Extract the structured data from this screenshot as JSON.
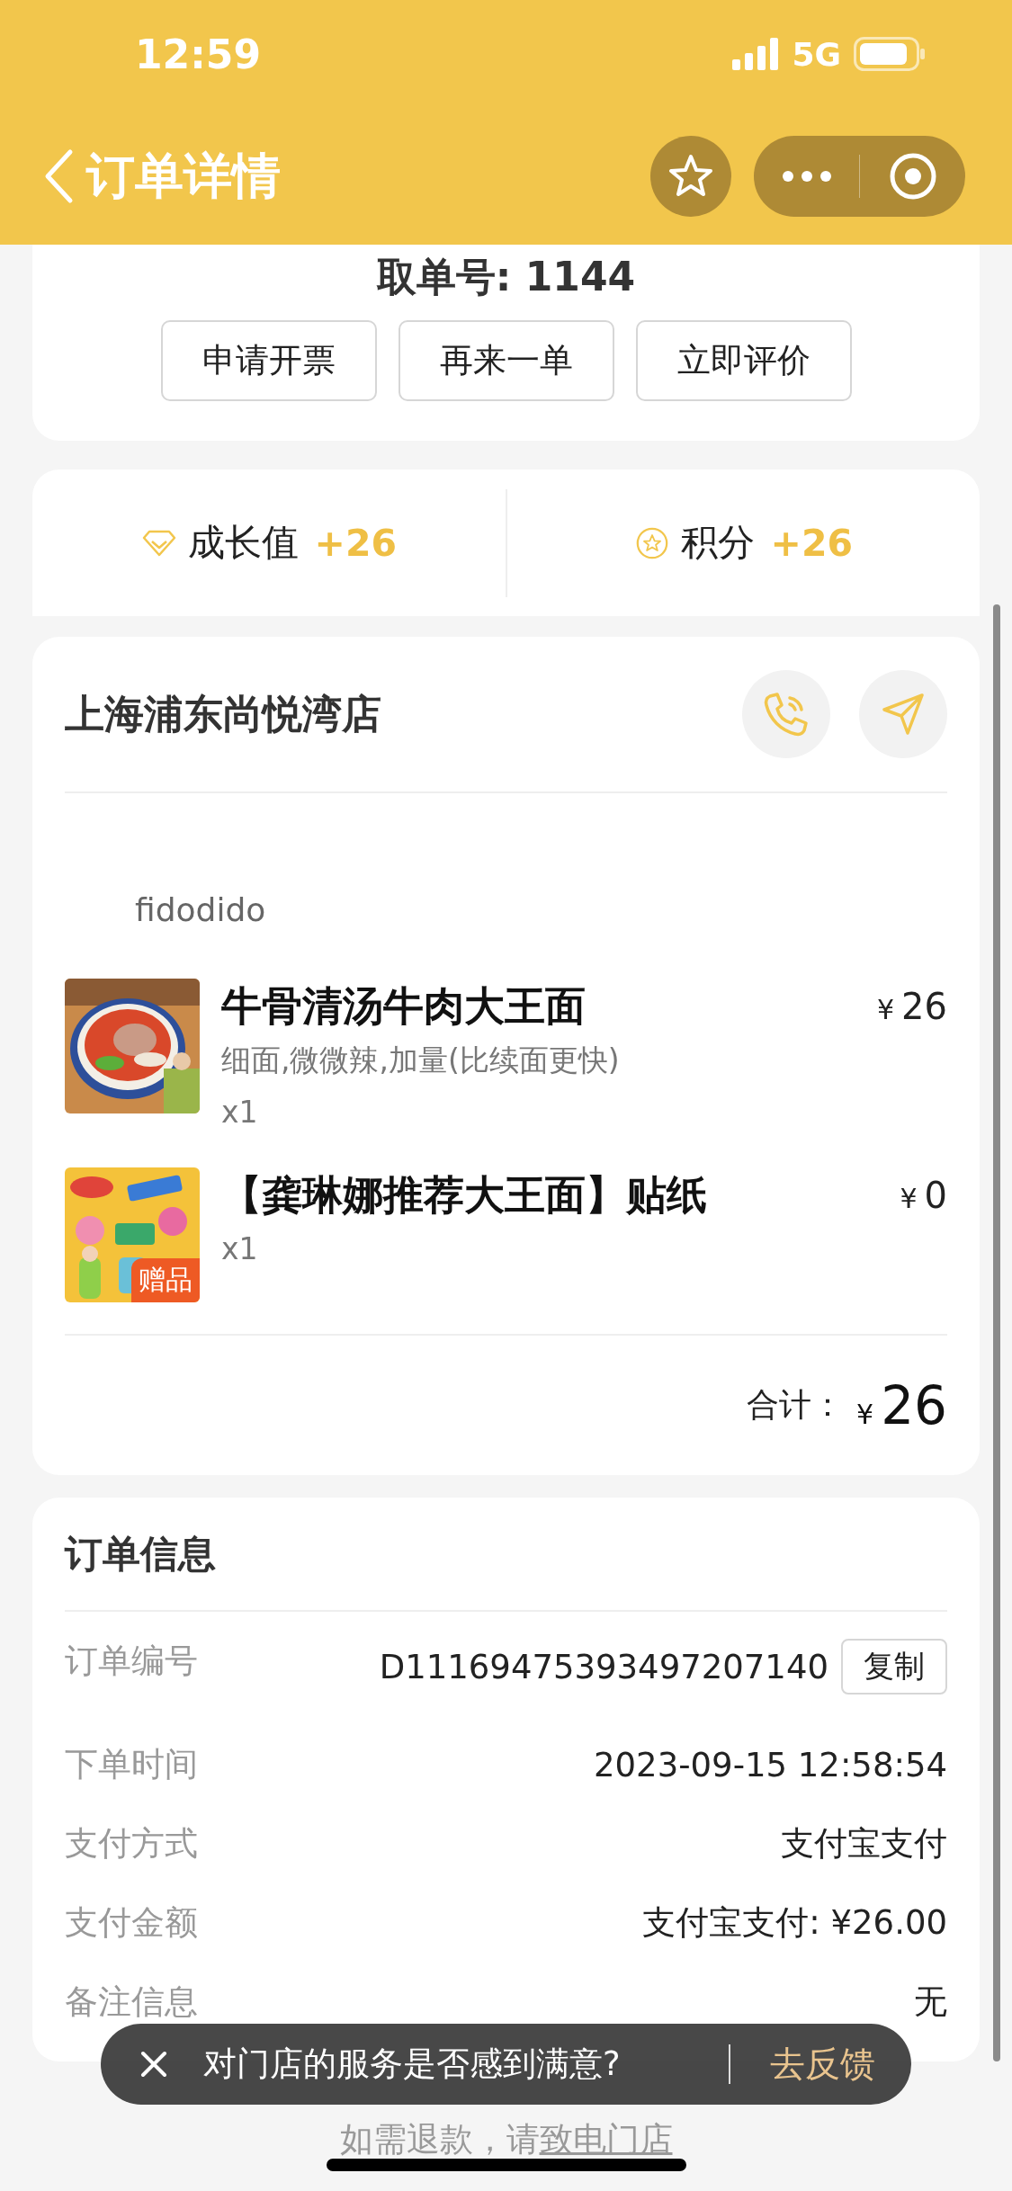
{
  "status_bar": {
    "time": "12:59",
    "network": "5G"
  },
  "nav": {
    "title": "订单详情"
  },
  "pickup": {
    "label": "取单号: 1144"
  },
  "actions": [
    "申请开票",
    "再来一单",
    "立即评价"
  ],
  "rewards": [
    {
      "kind": "growth",
      "label": "成长值",
      "value": "+26"
    },
    {
      "kind": "points",
      "label": "积分",
      "value": "+26"
    }
  ],
  "store": {
    "name": "上海浦东尚悦湾店"
  },
  "customer_name": "fidodido",
  "items": [
    {
      "kind": "noodle",
      "name": "牛骨清汤牛肉大王面",
      "options": "细面,微微辣,加量(比续面更快)",
      "quantity": "x1",
      "currency": "¥",
      "amount": "26"
    },
    {
      "kind": "sticker",
      "name": "【龚琳娜推荐大王面】贴纸",
      "quantity": "x1",
      "currency": "¥",
      "amount": "0",
      "badge": "赠品"
    }
  ],
  "total": {
    "label": "合计：",
    "currency": "¥",
    "amount": "26"
  },
  "order_info": {
    "title": "订单信息",
    "rows": [
      {
        "label": "订单编号",
        "value": "D11169475393497207140",
        "action": "复制"
      },
      {
        "label": "下单时间",
        "value": "2023-09-15 12:58:54"
      },
      {
        "label": "支付方式",
        "value": "支付宝支付"
      },
      {
        "label": "支付金额",
        "value": "支付宝支付: ¥26.00"
      },
      {
        "label": "备注信息",
        "value": "无"
      }
    ]
  },
  "toast": {
    "message": "对门店的服务是否感到满意?",
    "action": "去反馈"
  },
  "footer": {
    "text": "如需退款，请",
    "link": "致电门店"
  }
}
